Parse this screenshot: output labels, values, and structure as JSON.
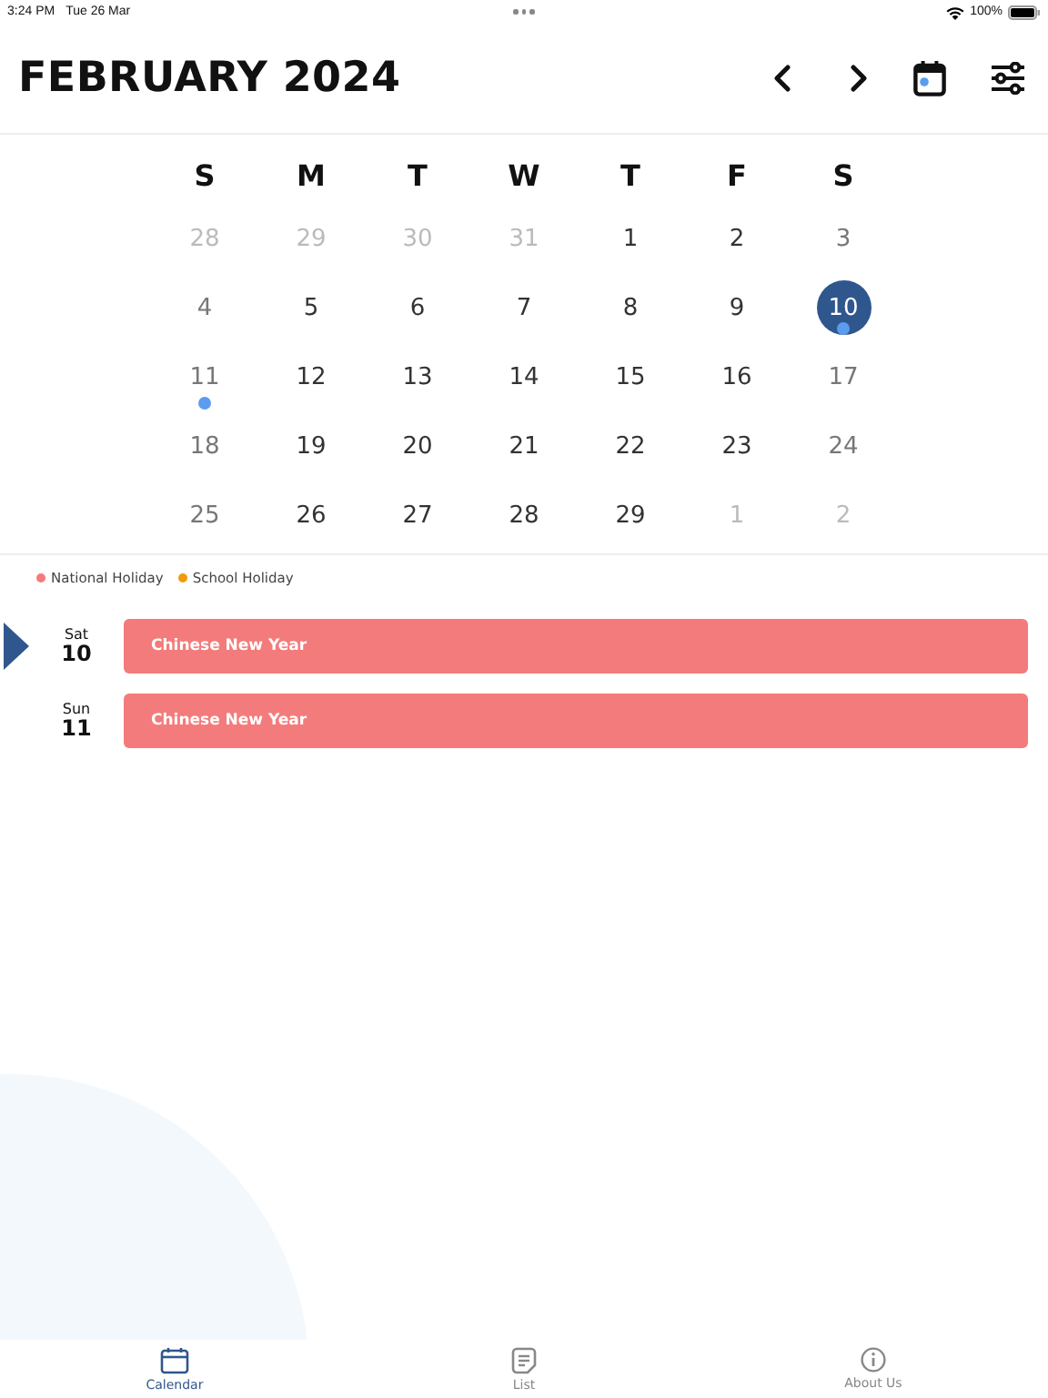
{
  "status_bar": {
    "time": "3:24 PM",
    "date": "Tue 26 Mar",
    "battery": "100%"
  },
  "header": {
    "title": "FEBRUARY 2024"
  },
  "weekdays": [
    "S",
    "M",
    "T",
    "W",
    "T",
    "F",
    "S"
  ],
  "weeks": [
    [
      {
        "day": "28",
        "muted": true,
        "selected": false,
        "event": false
      },
      {
        "day": "29",
        "muted": true,
        "selected": false,
        "event": false
      },
      {
        "day": "30",
        "muted": true,
        "selected": false,
        "event": false
      },
      {
        "day": "31",
        "muted": true,
        "selected": false,
        "event": false
      },
      {
        "day": "1",
        "muted": false,
        "selected": false,
        "event": false
      },
      {
        "day": "2",
        "muted": false,
        "selected": false,
        "event": false
      },
      {
        "day": "3",
        "muted": false,
        "selected": false,
        "event": false
      }
    ],
    [
      {
        "day": "4",
        "muted": false,
        "selected": false,
        "event": false
      },
      {
        "day": "5",
        "muted": false,
        "selected": false,
        "event": false
      },
      {
        "day": "6",
        "muted": false,
        "selected": false,
        "event": false
      },
      {
        "day": "7",
        "muted": false,
        "selected": false,
        "event": false
      },
      {
        "day": "8",
        "muted": false,
        "selected": false,
        "event": false
      },
      {
        "day": "9",
        "muted": false,
        "selected": false,
        "event": false
      },
      {
        "day": "10",
        "muted": false,
        "selected": true,
        "event": true
      }
    ],
    [
      {
        "day": "11",
        "muted": false,
        "selected": false,
        "event": true
      },
      {
        "day": "12",
        "muted": false,
        "selected": false,
        "event": false
      },
      {
        "day": "13",
        "muted": false,
        "selected": false,
        "event": false
      },
      {
        "day": "14",
        "muted": false,
        "selected": false,
        "event": false
      },
      {
        "day": "15",
        "muted": false,
        "selected": false,
        "event": false
      },
      {
        "day": "16",
        "muted": false,
        "selected": false,
        "event": false
      },
      {
        "day": "17",
        "muted": false,
        "selected": false,
        "event": false
      }
    ],
    [
      {
        "day": "18",
        "muted": false,
        "selected": false,
        "event": false
      },
      {
        "day": "19",
        "muted": false,
        "selected": false,
        "event": false
      },
      {
        "day": "20",
        "muted": false,
        "selected": false,
        "event": false
      },
      {
        "day": "21",
        "muted": false,
        "selected": false,
        "event": false
      },
      {
        "day": "22",
        "muted": false,
        "selected": false,
        "event": false
      },
      {
        "day": "23",
        "muted": false,
        "selected": false,
        "event": false
      },
      {
        "day": "24",
        "muted": false,
        "selected": false,
        "event": false
      }
    ],
    [
      {
        "day": "25",
        "muted": false,
        "selected": false,
        "event": false
      },
      {
        "day": "26",
        "muted": false,
        "selected": false,
        "event": false
      },
      {
        "day": "27",
        "muted": false,
        "selected": false,
        "event": false
      },
      {
        "day": "28",
        "muted": false,
        "selected": false,
        "event": false
      },
      {
        "day": "29",
        "muted": false,
        "selected": false,
        "event": false
      },
      {
        "day": "1",
        "muted": true,
        "selected": false,
        "event": false
      },
      {
        "day": "2",
        "muted": true,
        "selected": false,
        "event": false
      }
    ]
  ],
  "legend": [
    {
      "label": "National Holiday",
      "color": "#f47b7b"
    },
    {
      "label": "School Holiday",
      "color": "#f09a0c"
    }
  ],
  "events": [
    {
      "weekday": "Sat",
      "day": "10",
      "title": "Chinese New Year",
      "selected": true,
      "color": "#f47b7b"
    },
    {
      "weekday": "Sun",
      "day": "11",
      "title": "Chinese New Year",
      "selected": false,
      "color": "#f47b7b"
    }
  ],
  "tab_bar": [
    {
      "label": "Calendar",
      "kind": "calendar",
      "selected": true
    },
    {
      "label": "List",
      "kind": "list",
      "selected": false
    },
    {
      "label": "About Us",
      "kind": "info",
      "selected": false
    }
  ]
}
